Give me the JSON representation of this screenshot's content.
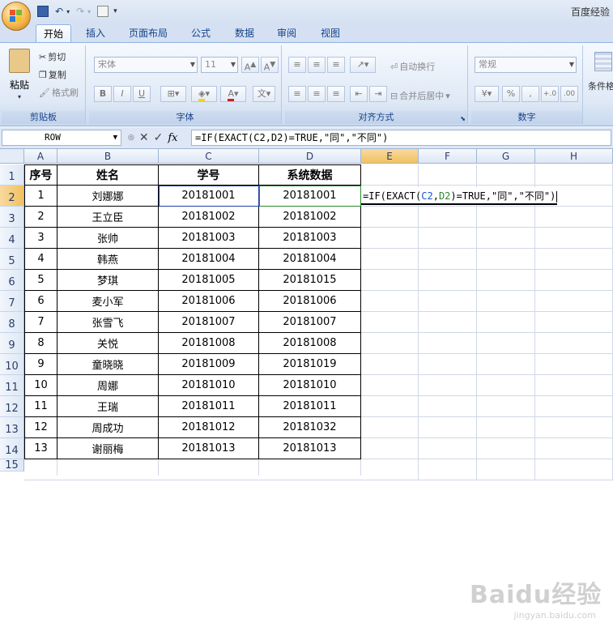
{
  "titlebar": {
    "title": "百度经验"
  },
  "tabs": [
    "开始",
    "插入",
    "页面布局",
    "公式",
    "数据",
    "审阅",
    "视图"
  ],
  "ribbon": {
    "clipboard": {
      "paste": "粘贴",
      "cut": "剪切",
      "copy": "复制",
      "format_painter": "格式刷",
      "label": "剪贴板"
    },
    "font": {
      "font_name": "宋体",
      "font_size": "11",
      "bold": "B",
      "italic": "I",
      "underline": "U",
      "label": "字体"
    },
    "alignment": {
      "wrap": "自动换行",
      "merge": "合并后居中",
      "label": "对齐方式"
    },
    "number": {
      "format": "常规",
      "percent": "%",
      "comma": ",",
      "label": "数字"
    },
    "styles": {
      "cond_format": "条件格"
    }
  },
  "formula_bar": {
    "name_box": "ROW",
    "fx": "fx",
    "formula": "=IF(EXACT(C2,D2)=TRUE,\"同\",\"不同\")"
  },
  "columns": [
    "A",
    "B",
    "C",
    "D",
    "E",
    "F",
    "G",
    "H"
  ],
  "rows": [
    "1",
    "2",
    "3",
    "4",
    "5",
    "6",
    "7",
    "8",
    "9",
    "10",
    "11",
    "12",
    "13",
    "14",
    "15"
  ],
  "table": {
    "headers": [
      "序号",
      "姓名",
      "学号",
      "系统数据"
    ],
    "rows": [
      [
        "1",
        "刘娜娜",
        "20181001",
        "20181001"
      ],
      [
        "2",
        "王立臣",
        "20181002",
        "20181002"
      ],
      [
        "3",
        "张帅",
        "20181003",
        "20181003"
      ],
      [
        "4",
        "韩燕",
        "20181004",
        "20181004"
      ],
      [
        "5",
        "梦琪",
        "20181005",
        "20181015"
      ],
      [
        "6",
        "麦小军",
        "20181006",
        "20181006"
      ],
      [
        "7",
        "张雪飞",
        "20181007",
        "20181007"
      ],
      [
        "8",
        "关悦",
        "20181008",
        "20181008"
      ],
      [
        "9",
        "童晓晓",
        "20181009",
        "20181019"
      ],
      [
        "10",
        "周娜",
        "20181010",
        "20181010"
      ],
      [
        "11",
        "王瑞",
        "20181011",
        "20181011"
      ],
      [
        "12",
        "周成功",
        "20181012",
        "20181032"
      ],
      [
        "13",
        "谢丽梅",
        "20181013",
        "20181013"
      ]
    ]
  },
  "editing_cell": {
    "prefix": "=IF(EXACT(",
    "ref1": "C2",
    "sep": ",",
    "ref2": "D2",
    "suffix": ")=TRUE,\"同\",\"不同\")"
  },
  "watermark": {
    "brand": "Baidu经验",
    "url": "jingyan.baidu.com"
  },
  "colors": {
    "ribbon_text": "#15428b",
    "ref_blue": "#1a56c8",
    "ref_green": "#2c8a2c",
    "selected_header": "#f1c15f"
  }
}
